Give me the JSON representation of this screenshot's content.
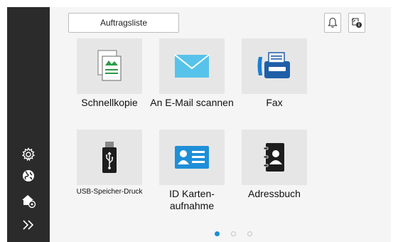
{
  "header": {
    "job_list_label": "Auftragsliste",
    "bell_icon": "bell-icon",
    "job_status_icon": "job-status-icon"
  },
  "sidebar": {
    "items": [
      {
        "icon": "settings-gear-icon"
      },
      {
        "icon": "globe-icon"
      },
      {
        "icon": "home-settings-icon"
      },
      {
        "icon": "double-chevron-right-icon"
      }
    ]
  },
  "apps": [
    {
      "label": "Schnellkopie",
      "icon": "copy-document-icon"
    },
    {
      "label": "An E-Mail scannen",
      "icon": "mail-envelope-icon"
    },
    {
      "label": "Fax",
      "icon": "fax-machine-icon"
    },
    {
      "label": "USB-Speicher-Druck",
      "icon": "usb-drive-icon"
    },
    {
      "label": "ID Karten-aufnahme",
      "icon": "id-card-icon"
    },
    {
      "label": "Adressbuch",
      "icon": "address-book-icon"
    }
  ],
  "pagination": {
    "current": 1,
    "total": 3
  },
  "colors": {
    "sidebar_bg": "#2b2b2b",
    "accent_blue": "#1a8fd6",
    "tile_bg": "#e6e6e6"
  }
}
